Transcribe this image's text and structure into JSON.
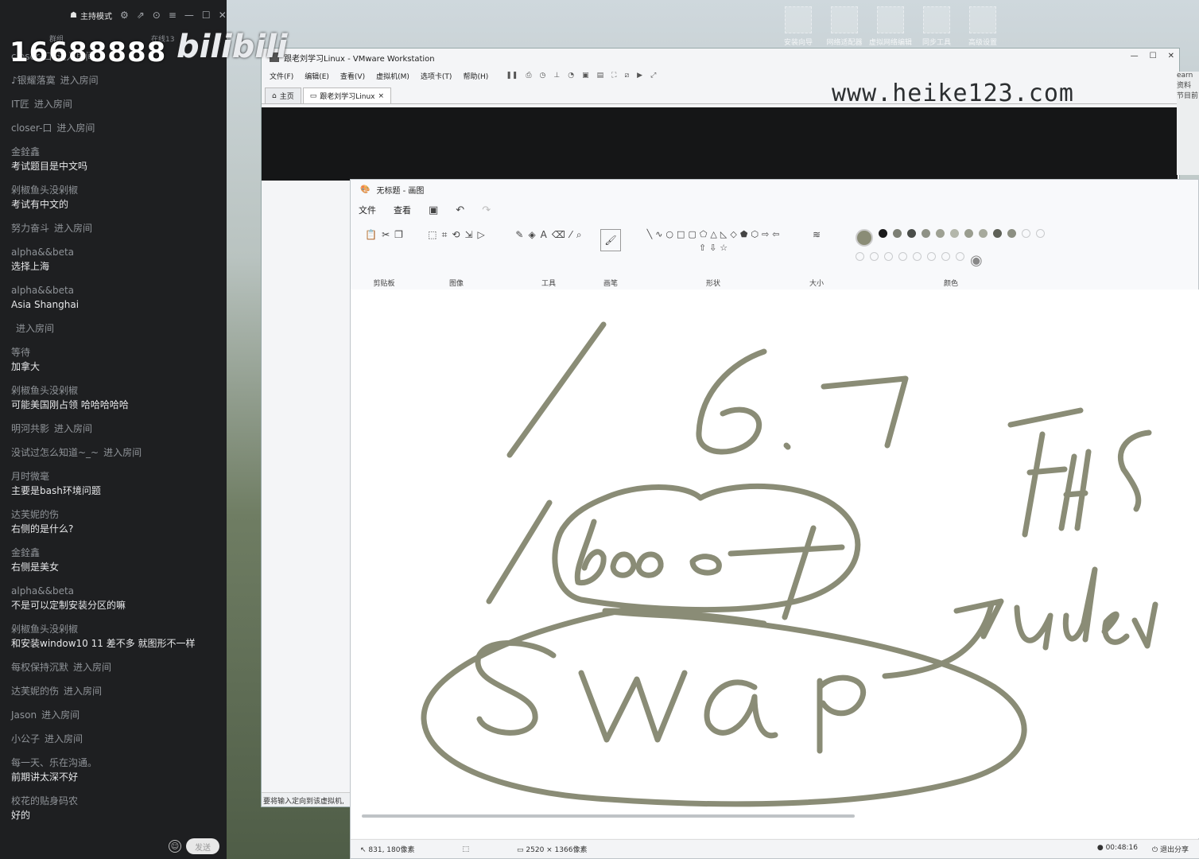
{
  "overlay": {
    "number": "16688888",
    "brand": "bilibili"
  },
  "chat": {
    "mode_label": "主持模式",
    "sub_left": "群组",
    "sub_right": "在线13",
    "messages": [
      {
        "user": "closer-口",
        "text": "",
        "enter": "进入房间"
      },
      {
        "user": "♪银耀落寞",
        "text": "",
        "enter": "进入房间"
      },
      {
        "user": "IT匠",
        "text": "",
        "enter": "进入房间"
      },
      {
        "user": "closer-口",
        "text": "",
        "enter": "进入房间"
      },
      {
        "user": "金銓鑫",
        "text": "考试题目是中文吗",
        "enter": ""
      },
      {
        "user": "剁椒鱼头没剁椒",
        "text": "考试有中文的",
        "enter": ""
      },
      {
        "user": "努力奋斗",
        "text": "",
        "enter": "进入房间"
      },
      {
        "user": "alpha&&beta",
        "text": "选择上海",
        "enter": ""
      },
      {
        "user": "alpha&&beta",
        "text": "Asia Shanghai",
        "enter": ""
      },
      {
        "user": "",
        "text": "",
        "enter": "进入房间"
      },
      {
        "user": "等待",
        "text": "加拿大",
        "enter": ""
      },
      {
        "user": "剁椒鱼头没剁椒",
        "text": "可能美国刚占领  哈哈哈哈哈",
        "enter": ""
      },
      {
        "user": "明河共影",
        "text": "",
        "enter": "进入房间"
      },
      {
        "user": "没试过怎么知道~_~",
        "text": "",
        "enter": "进入房间"
      },
      {
        "user": "月时微毫",
        "text": "主要是bash环境问题",
        "enter": ""
      },
      {
        "user": "达芙妮的伤",
        "text": "右侧的是什么?",
        "enter": ""
      },
      {
        "user": "金銓鑫",
        "text": "右侧是美女",
        "enter": ""
      },
      {
        "user": "alpha&&beta",
        "text": "不是可以定制安装分区的嘛",
        "enter": ""
      },
      {
        "user": "剁椒鱼头没剁椒",
        "text": "和安装window10 11 差不多   就图形不一样",
        "enter": ""
      },
      {
        "user": "每权保持沉默",
        "text": "",
        "enter": "进入房间"
      },
      {
        "user": "达芙妮的伤",
        "text": "",
        "enter": "进入房间"
      },
      {
        "user": "Jason",
        "text": "",
        "enter": "进入房间"
      },
      {
        "user": "小公子",
        "text": "",
        "enter": "进入房间"
      },
      {
        "user": "每一天、乐在沟通。",
        "text": "前期讲太深不好",
        "enter": ""
      },
      {
        "user": "校花的贴身码农",
        "text": "好的",
        "enter": ""
      }
    ],
    "send_label": "发送"
  },
  "desktop": {
    "icons": [
      "安装向导",
      "网络适配器",
      "虚拟网络编辑",
      "同步工具",
      "高级设置"
    ]
  },
  "vmware": {
    "title": "跟老刘学习Linux - VMware Workstation",
    "menus": [
      "文件(F)",
      "编辑(E)",
      "查看(V)",
      "虚拟机(M)",
      "选项卡(T)",
      "帮助(H)"
    ],
    "tabs": [
      "主页",
      "跟老刘学习Linux"
    ],
    "status": "要将输入定向到该虚拟机,"
  },
  "watermark": "www.heike123.com",
  "right_strip": [
    "earn",
    "资料",
    "节目前"
  ],
  "paint": {
    "title": "无标题 - 画图",
    "menus": [
      "文件",
      "查看"
    ],
    "groups": [
      "剪贴板",
      "图像",
      "工具",
      "画笔",
      "形状",
      "大小",
      "颜色"
    ],
    "status_pos": "831, 180像素",
    "status_size": "2520 × 1366像素",
    "timer": "00:48:16",
    "exit_share": "退出分享"
  },
  "colors": {
    "ink": "#8a8c76",
    "chat_bg": "#1e1f21",
    "palette": [
      "#1b1b1b",
      "#7c7f74",
      "#4a4d49",
      "#8f9286",
      "#9ea193",
      "#b4b7ab",
      "#9a9d8f",
      "#a7aa9d",
      "#5e6157",
      "#8c8f82"
    ]
  }
}
